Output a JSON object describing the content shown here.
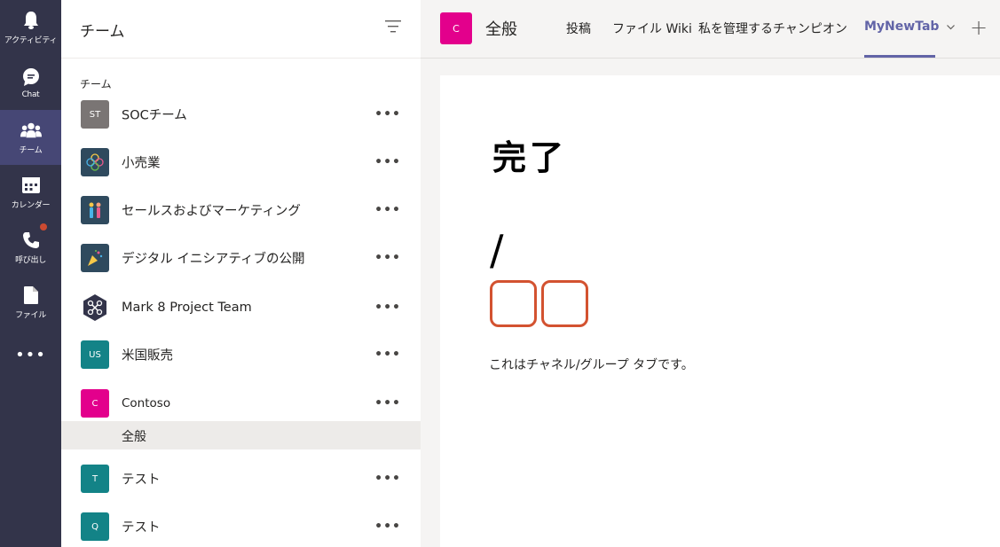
{
  "rail": {
    "items": [
      {
        "label": "アクティビティ",
        "icon": "bell-icon"
      },
      {
        "label": "Chat",
        "icon": "chat-icon"
      },
      {
        "label": "チーム",
        "icon": "teams-icon"
      },
      {
        "label": "カレンダー",
        "icon": "calendar-icon"
      },
      {
        "label": "呼び出し",
        "icon": "phone-icon"
      },
      {
        "label": "ファイル",
        "icon": "file-icon"
      }
    ],
    "more": "•••"
  },
  "panel": {
    "title": "チーム",
    "section_label": "チーム",
    "teams": [
      {
        "name": "SOCチーム",
        "initials": "ST",
        "color": "#7a7574"
      },
      {
        "name": "小売業",
        "initials": "",
        "color": "#2f4a5e"
      },
      {
        "name": "セールスおよびマーケティング",
        "initials": "",
        "color": "#2f4a5e"
      },
      {
        "name": "デジタル イニシアティブの公開",
        "initials": "",
        "color": "#2f4a5e"
      },
      {
        "name": "Mark 8 Project Team",
        "initials": "",
        "color": "#33344a"
      },
      {
        "name": "米国販売",
        "initials": "US",
        "color": "#138387"
      },
      {
        "name": "Contoso",
        "initials": "C",
        "color": "#e3008c"
      },
      {
        "name": "テスト",
        "initials": "T",
        "color": "#138387"
      },
      {
        "name": "テスト",
        "initials": "Q",
        "color": "#138387"
      }
    ],
    "channel": "全般",
    "more": "•••"
  },
  "header": {
    "avatar_initials": "C",
    "channel_title": "全般",
    "tabs": [
      "投稿",
      "ファイル Wiki",
      "私を管理するチャンピオン",
      "MyNewTab"
    ],
    "active_tab": "MyNewTab",
    "add_tab": "+"
  },
  "content": {
    "title": "完了",
    "slash": "/",
    "description": "これはチャネル/グループ タブです。"
  },
  "colors": {
    "rail": "#33344a",
    "accent": "#6264a7",
    "box_border": "#d35230"
  }
}
